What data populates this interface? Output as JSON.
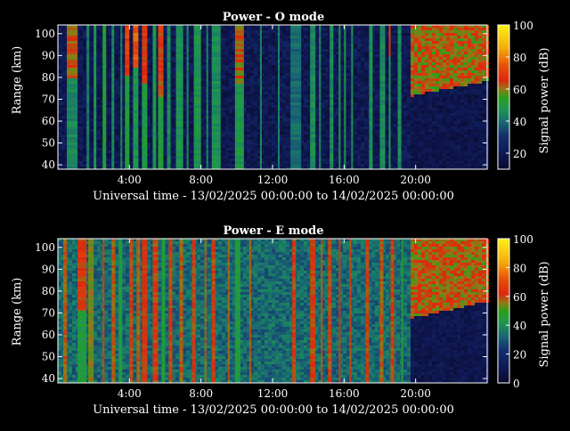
{
  "chart_data": [
    {
      "type": "heatmap",
      "title": "Power - O mode",
      "xlabel": "Universal time - 13/02/2025 00:00:00 to 14/02/2025 00:00:00",
      "ylabel": "Range (km)",
      "colorbar_label": "Signal power (dB)",
      "x_ticks": [
        "4:00",
        "8:00",
        "12:00",
        "16:00",
        "20:00"
      ],
      "x_tick_hours": [
        4,
        8,
        12,
        16,
        20
      ],
      "xlim_hours": [
        0,
        24
      ],
      "y_ticks": [
        40,
        50,
        60,
        70,
        80,
        90,
        100
      ],
      "ylim": [
        38,
        104
      ],
      "colorbar_ticks": [
        20,
        40,
        60,
        80,
        100
      ],
      "colorbar_range": [
        10,
        100
      ],
      "background_level": 20,
      "night_block": {
        "start_hour": 19.6,
        "floor_km": 72,
        "floor_end_km": 79,
        "low_level": 18,
        "high_level": 62
      },
      "stripes": [
        {
          "start_hour": 0.5,
          "end_hour": 1.1,
          "level": 45,
          "top_level": 62,
          "top_from_km": 80
        },
        {
          "start_hour": 1.6,
          "end_hour": 1.75,
          "level": 42
        },
        {
          "start_hour": 2.0,
          "end_hour": 2.15,
          "level": 48
        },
        {
          "start_hour": 2.5,
          "end_hour": 2.7,
          "level": 52
        },
        {
          "start_hour": 3.0,
          "end_hour": 3.15,
          "level": 45
        },
        {
          "start_hour": 3.5,
          "end_hour": 3.6,
          "level": 45
        },
        {
          "start_hour": 3.75,
          "end_hour": 4.0,
          "level": 50,
          "top_level": 70,
          "top_from_km": 82
        },
        {
          "start_hour": 4.2,
          "end_hour": 4.5,
          "level": 48,
          "top_level": 75,
          "top_from_km": 85
        },
        {
          "start_hour": 4.7,
          "end_hour": 5.0,
          "level": 50,
          "top_level": 68,
          "top_from_km": 78
        },
        {
          "start_hour": 5.3,
          "end_hour": 5.5,
          "level": 48
        },
        {
          "start_hour": 5.6,
          "end_hour": 5.9,
          "level": 50,
          "top_level": 66,
          "top_from_km": 72
        },
        {
          "start_hour": 6.1,
          "end_hour": 6.3,
          "level": 45
        },
        {
          "start_hour": 6.6,
          "end_hour": 7.0,
          "level": 47
        },
        {
          "start_hour": 7.2,
          "end_hour": 7.3,
          "level": 45
        },
        {
          "start_hour": 7.6,
          "end_hour": 8.0,
          "level": 48
        },
        {
          "start_hour": 8.3,
          "end_hour": 8.4,
          "level": 44
        },
        {
          "start_hour": 8.6,
          "end_hour": 9.1,
          "level": 46
        },
        {
          "start_hour": 9.9,
          "end_hour": 10.4,
          "level": 48,
          "top_level": 62,
          "top_from_km": 78
        },
        {
          "start_hour": 11.3,
          "end_hour": 11.4,
          "level": 44
        },
        {
          "start_hour": 12.3,
          "end_hour": 12.4,
          "level": 44
        },
        {
          "start_hour": 13.0,
          "end_hour": 13.6,
          "level": 40
        },
        {
          "start_hour": 14.1,
          "end_hour": 14.4,
          "level": 46
        },
        {
          "start_hour": 14.6,
          "end_hour": 14.7,
          "level": 44
        },
        {
          "start_hour": 15.2,
          "end_hour": 15.4,
          "level": 46
        },
        {
          "start_hour": 15.7,
          "end_hour": 15.8,
          "level": 48
        },
        {
          "start_hour": 16.0,
          "end_hour": 16.1,
          "level": 48
        },
        {
          "start_hour": 16.4,
          "end_hour": 16.5,
          "level": 46
        },
        {
          "start_hour": 17.4,
          "end_hour": 17.6,
          "level": 46
        },
        {
          "start_hour": 18.0,
          "end_hour": 18.3,
          "level": 46
        },
        {
          "start_hour": 18.5,
          "end_hour": 18.6,
          "level": 48,
          "top_level": 68,
          "top_from_km": 90
        },
        {
          "start_hour": 19.0,
          "end_hour": 19.2,
          "level": 46
        }
      ]
    },
    {
      "type": "heatmap",
      "title": "Power - E mode",
      "xlabel": "Universal time - 13/02/2025 00:00:00 to 14/02/2025 00:00:00",
      "ylabel": "Range (km)",
      "colorbar_label": "Signal power (dB)",
      "x_ticks": [
        "4:00",
        "8:00",
        "12:00",
        "16:00",
        "20:00"
      ],
      "x_tick_hours": [
        4,
        8,
        12,
        16,
        20
      ],
      "xlim_hours": [
        0,
        24
      ],
      "y_ticks": [
        40,
        50,
        60,
        70,
        80,
        90,
        100
      ],
      "ylim": [
        38,
        104
      ],
      "colorbar_ticks": [
        0,
        20,
        40,
        60,
        80,
        100
      ],
      "colorbar_range": [
        0,
        100
      ],
      "background_level": 33,
      "night_block": {
        "start_hour": 19.6,
        "floor_km": 68,
        "floor_end_km": 76,
        "low_level": 10,
        "high_level": 58
      },
      "stripes": [
        {
          "start_hour": 0.3,
          "end_hour": 0.5,
          "level": 58
        },
        {
          "start_hour": 1.1,
          "end_hour": 1.6,
          "level": 45,
          "top_level": 62,
          "top_from_km": 72
        },
        {
          "start_hour": 1.7,
          "end_hour": 2.0,
          "level": 55
        },
        {
          "start_hour": 2.5,
          "end_hour": 2.6,
          "level": 60
        },
        {
          "start_hour": 3.0,
          "end_hour": 3.2,
          "level": 58
        },
        {
          "start_hour": 3.4,
          "end_hour": 3.6,
          "level": 45
        },
        {
          "start_hour": 4.0,
          "end_hour": 4.2,
          "level": 60
        },
        {
          "start_hour": 4.4,
          "end_hour": 4.6,
          "level": 58
        },
        {
          "start_hour": 4.7,
          "end_hour": 5.0,
          "level": 62
        },
        {
          "start_hour": 5.3,
          "end_hour": 5.6,
          "level": 60
        },
        {
          "start_hour": 5.8,
          "end_hour": 6.0,
          "level": 45
        },
        {
          "start_hour": 6.2,
          "end_hour": 6.4,
          "level": 60
        },
        {
          "start_hour": 6.8,
          "end_hour": 7.0,
          "level": 58
        },
        {
          "start_hour": 7.5,
          "end_hour": 7.7,
          "level": 60
        },
        {
          "start_hour": 8.2,
          "end_hour": 8.3,
          "level": 58
        },
        {
          "start_hour": 8.6,
          "end_hour": 8.8,
          "level": 60
        },
        {
          "start_hour": 9.5,
          "end_hour": 9.6,
          "level": 58
        },
        {
          "start_hour": 9.9,
          "end_hour": 10.2,
          "level": 45
        },
        {
          "start_hour": 10.7,
          "end_hour": 10.8,
          "level": 58
        },
        {
          "start_hour": 13.1,
          "end_hour": 13.3,
          "level": 60
        },
        {
          "start_hour": 14.1,
          "end_hour": 14.4,
          "level": 60
        },
        {
          "start_hour": 14.7,
          "end_hour": 14.8,
          "level": 58
        },
        {
          "start_hour": 15.1,
          "end_hour": 15.3,
          "level": 60
        },
        {
          "start_hour": 15.7,
          "end_hour": 15.8,
          "level": 62
        },
        {
          "start_hour": 16.3,
          "end_hour": 16.4,
          "level": 60
        },
        {
          "start_hour": 17.2,
          "end_hour": 17.4,
          "level": 60
        },
        {
          "start_hour": 18.0,
          "end_hour": 18.2,
          "level": 58
        },
        {
          "start_hour": 18.6,
          "end_hour": 18.8,
          "level": 60
        },
        {
          "start_hour": 19.2,
          "end_hour": 19.3,
          "level": 45
        }
      ]
    }
  ]
}
